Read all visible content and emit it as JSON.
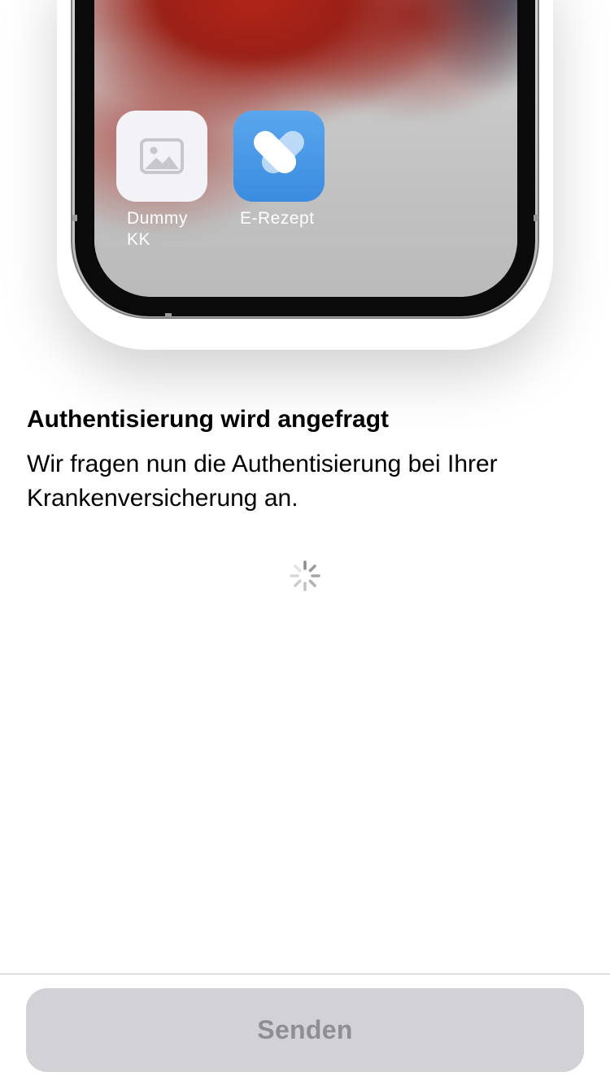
{
  "illustration": {
    "apps": [
      {
        "label": "Dummy KK",
        "icon": "image-placeholder-icon"
      },
      {
        "label": "E-Rezept",
        "icon": "heart-app-icon"
      }
    ]
  },
  "content": {
    "title": "Authentisierung wird angefragt",
    "description": "Wir fragen nun die Authentisierung bei Ihrer Krankenversicherung an."
  },
  "footer": {
    "send_label": "Senden",
    "send_enabled": false
  },
  "colors": {
    "button_disabled_bg": "#d1d1d6",
    "button_disabled_text": "#8e8e93",
    "app_blue": "#4a9ae8"
  }
}
